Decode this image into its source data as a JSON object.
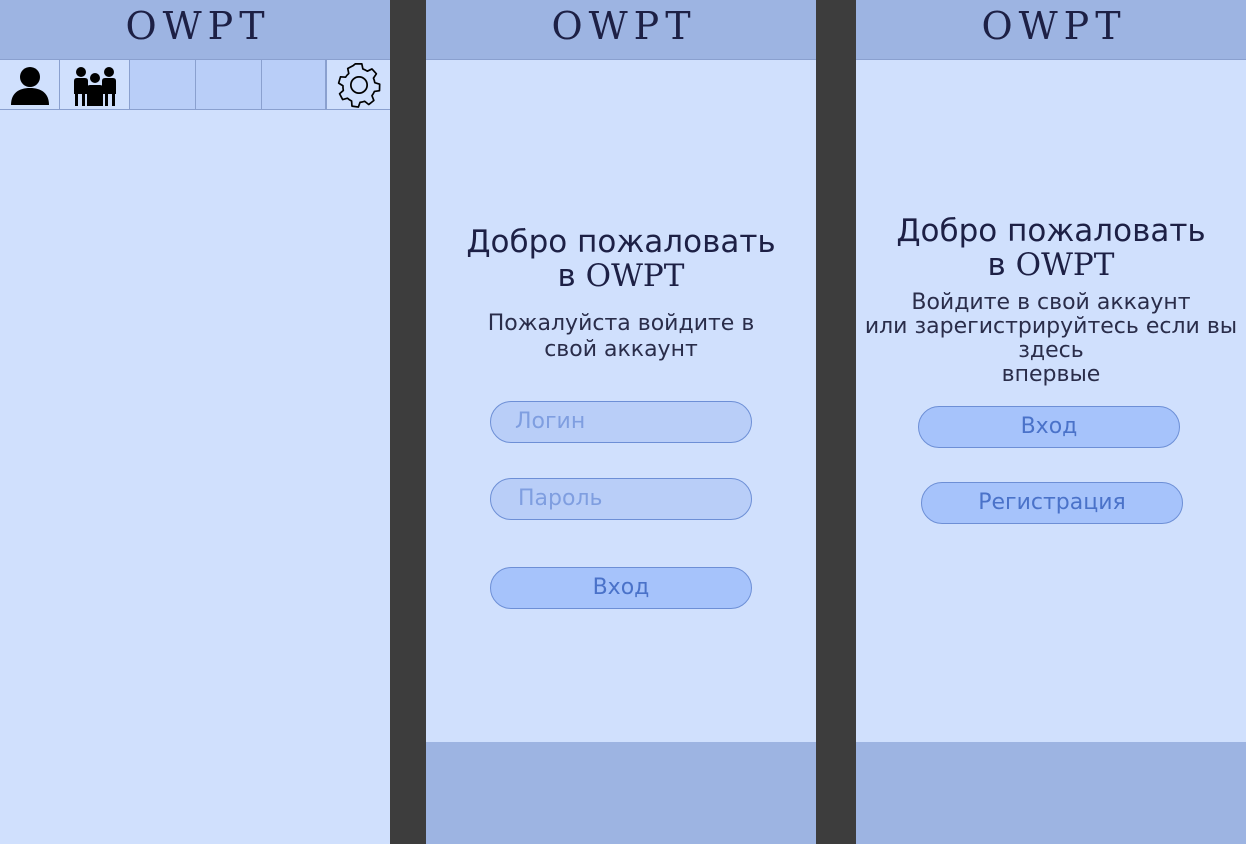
{
  "app": {
    "name": "OWPT"
  },
  "main_screen": {
    "title": "OWPT",
    "toolbar": [
      {
        "icon": "user-icon",
        "label": ""
      },
      {
        "icon": "group-icon",
        "label": ""
      },
      {
        "icon": "",
        "label": ""
      },
      {
        "icon": "",
        "label": ""
      },
      {
        "icon": "",
        "label": ""
      },
      {
        "icon": "gear-icon",
        "label": ""
      }
    ]
  },
  "login_screen": {
    "title": "OWPT",
    "welcome_line1": "Добро пожаловать",
    "welcome_prefix": "в ",
    "welcome_brand": "OWPT",
    "prompt_line1": "Пожалуйста войдите в",
    "prompt_line2": "свой аккаунт",
    "login_placeholder": "Логин",
    "password_placeholder": "Пароль",
    "login_button": "Вход"
  },
  "welcome_screen": {
    "title": "OWPT",
    "welcome_line1": "Добро пожаловать",
    "welcome_prefix": "в ",
    "welcome_brand": "OWPT",
    "info_line1": "Войдите в свой аккаунт",
    "info_line2": "или зарегистрируйтесь если вы",
    "info_line3": "здесь",
    "info_line4": "впервые",
    "login_button": "Вход",
    "register_button": "Регистрация"
  },
  "colors": {
    "header": "#9db4e2",
    "background": "#d0e0fd",
    "divider": "#3d3d3d",
    "button_fill": "#a6c3fb",
    "button_text": "#4a72c9",
    "text_dark": "#1d2045"
  }
}
